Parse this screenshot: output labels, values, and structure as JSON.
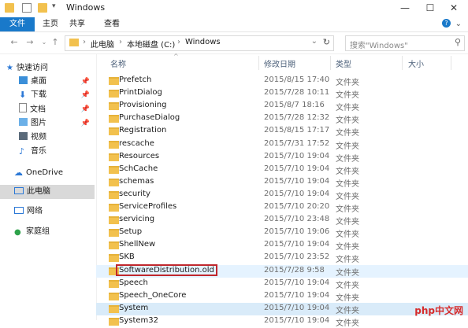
{
  "window": {
    "title": "Windows",
    "minimize": "—",
    "maximize": "☐",
    "close": "✕"
  },
  "ribbon": {
    "file": "文件",
    "home": "主页",
    "share": "共享",
    "view": "查看"
  },
  "address": {
    "crumbs": [
      "此电脑",
      "本地磁盘 (C:)",
      "Windows"
    ],
    "sep": "›"
  },
  "search": {
    "placeholder": "搜索\"Windows\""
  },
  "nav": {
    "quick_access": "快速访问",
    "items": [
      "桌面",
      "下载",
      "文档",
      "图片",
      "视频",
      "音乐"
    ],
    "onedrive": "OneDrive",
    "this_pc": "此电脑",
    "network": "网络",
    "homegroup": "家庭组"
  },
  "columns": {
    "name": "名称",
    "date": "修改日期",
    "type": "类型",
    "size": "大小"
  },
  "files": [
    {
      "name": "Prefetch",
      "date": "2015/8/15 17:40",
      "type": "文件夹"
    },
    {
      "name": "PrintDialog",
      "date": "2015/7/28 10:11",
      "type": "文件夹"
    },
    {
      "name": "Provisioning",
      "date": "2015/8/7 18:16",
      "type": "文件夹"
    },
    {
      "name": "PurchaseDialog",
      "date": "2015/7/28 12:32",
      "type": "文件夹"
    },
    {
      "name": "Registration",
      "date": "2015/8/15 17:17",
      "type": "文件夹"
    },
    {
      "name": "rescache",
      "date": "2015/7/31 17:52",
      "type": "文件夹"
    },
    {
      "name": "Resources",
      "date": "2015/7/10 19:04",
      "type": "文件夹"
    },
    {
      "name": "SchCache",
      "date": "2015/7/10 19:04",
      "type": "文件夹"
    },
    {
      "name": "schemas",
      "date": "2015/7/10 19:04",
      "type": "文件夹"
    },
    {
      "name": "security",
      "date": "2015/7/10 19:04",
      "type": "文件夹"
    },
    {
      "name": "ServiceProfiles",
      "date": "2015/7/10 20:20",
      "type": "文件夹"
    },
    {
      "name": "servicing",
      "date": "2015/7/10 23:48",
      "type": "文件夹"
    },
    {
      "name": "Setup",
      "date": "2015/7/10 19:06",
      "type": "文件夹"
    },
    {
      "name": "ShellNew",
      "date": "2015/7/10 19:04",
      "type": "文件夹"
    },
    {
      "name": "SKB",
      "date": "2015/7/10 23:52",
      "type": "文件夹"
    },
    {
      "name": "SoftwareDistribution.old",
      "date": "2015/7/28 9:58",
      "type": "文件夹"
    },
    {
      "name": "Speech",
      "date": "2015/7/10 19:04",
      "type": "文件夹"
    },
    {
      "name": "Speech_OneCore",
      "date": "2015/7/10 19:04",
      "type": "文件夹"
    },
    {
      "name": "System",
      "date": "2015/7/10 19:04",
      "type": "文件夹"
    },
    {
      "name": "System32",
      "date": "2015/7/10 19:04",
      "type": "文件夹"
    }
  ],
  "watermark": "php中文网"
}
